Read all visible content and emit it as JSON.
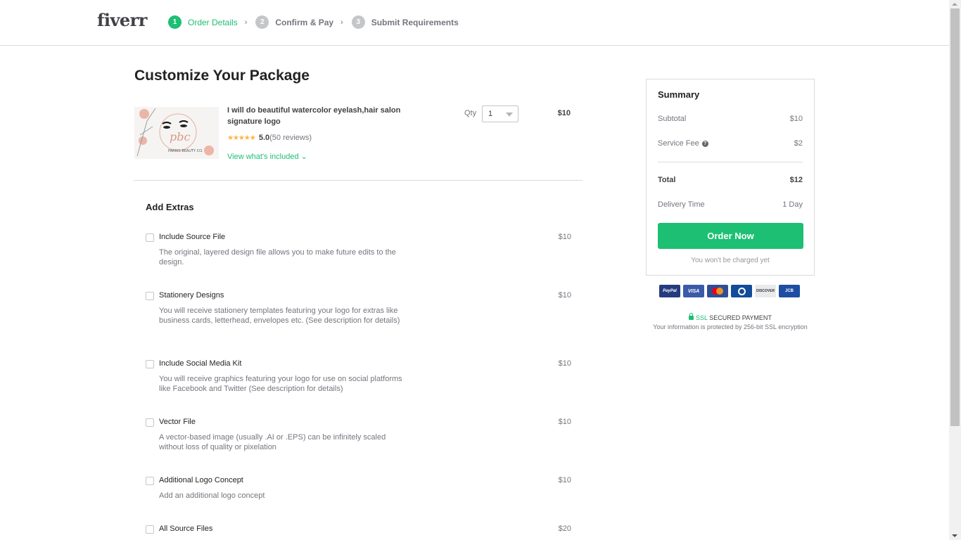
{
  "header": {
    "logo": "fiverr",
    "steps": [
      {
        "number": "1",
        "label": "Order Details",
        "active": true
      },
      {
        "number": "2",
        "label": "Confirm & Pay",
        "active": false
      },
      {
        "number": "3",
        "label": "Submit Requirements",
        "active": false
      }
    ],
    "step_separator": "›"
  },
  "main": {
    "title": "Customize Your Package",
    "gig": {
      "title": "I will do beautiful watercolor eyelash,hair salon signature logo",
      "image_alt": "PBC Parris Beauty Co logo",
      "stars": "★★★★★",
      "rating": "5.0",
      "reviews": "(50 reviews)",
      "view_included": "View what's included ⌄",
      "qty_label": "Qty",
      "qty_value": "1",
      "price": "$10"
    },
    "extras_title": "Add Extras",
    "extras": [
      {
        "name": "Include Source File",
        "description": "The original, layered design file allows you to make future edits to the design.",
        "price": "$10",
        "checked": false
      },
      {
        "name": "Stationery Designs",
        "description": "You will receive stationery templates featuring your logo for extras like business cards, letterhead, envelopes etc. (See description for details)",
        "price": "$10",
        "checked": false
      },
      {
        "name": "Include Social Media Kit",
        "description": "You will receive graphics featuring your logo for use on social platforms like Facebook and Twitter (See description for details)",
        "price": "$10",
        "checked": false
      },
      {
        "name": "Vector File",
        "description": "A vector-based image (usually .AI or .EPS) can be infinitely scaled without loss of quality or pixelation",
        "price": "$10",
        "checked": false
      },
      {
        "name": "Additional Logo Concept",
        "description": "Add an additional logo concept",
        "price": "$10",
        "checked": false
      },
      {
        "name": "All Source Files",
        "description": "",
        "price": "$20",
        "checked": false
      }
    ]
  },
  "summary": {
    "title": "Summary",
    "subtotal_label": "Subtotal",
    "subtotal_value": "$10",
    "service_fee_label": "Service Fee",
    "service_fee_value": "$2",
    "total_label": "Total",
    "total_value": "$12",
    "delivery_label": "Delivery Time",
    "delivery_value": "1 Day",
    "order_button": "Order Now",
    "not_charged": "You won't be charged yet"
  },
  "payment": {
    "cards": [
      "PayPal",
      "VISA",
      "MasterCard",
      "Diners Club",
      "DISCOVER",
      "JCB"
    ],
    "ssl_label": "SSL",
    "secured_label": "SECURED PAYMENT",
    "ssl_note": "Your information is protected by 256-bit SSL encryption"
  },
  "colors": {
    "brand_green": "#1dbf73",
    "text_dark": "#222325",
    "text_muted": "#74767e",
    "star": "#ffb33e"
  }
}
